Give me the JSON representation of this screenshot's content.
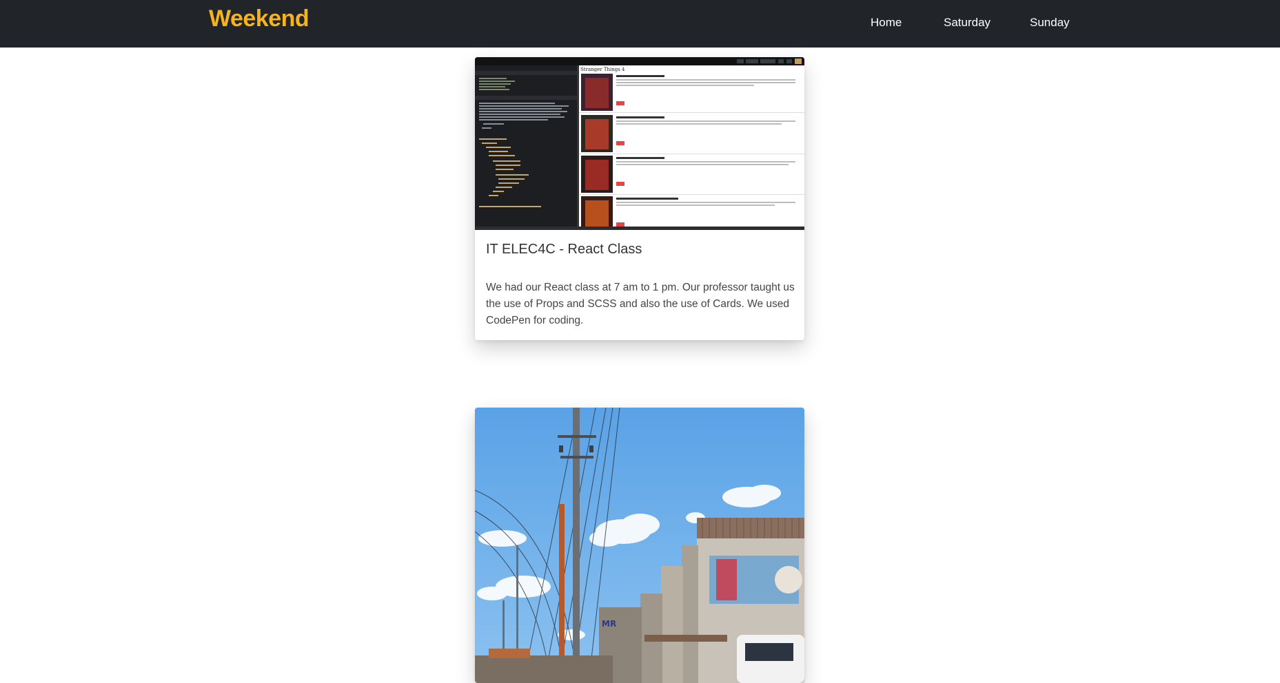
{
  "nav": {
    "brand": "Weekend",
    "links": [
      "Home",
      "Saturday",
      "Sunday"
    ],
    "background": "#212529",
    "brand_color": "#f5b41b"
  },
  "cards": [
    {
      "image": "code-editor-screenshot",
      "title": "IT ELEC4C - React Class",
      "text": "We had our React class at 7 am to 1 pm. Our professor taught us the use of Props and SCSS and also the use of Cards. We used CodePen for coding."
    },
    {
      "image": "street-photo-with-power-pole-and-buildings"
    }
  ]
}
